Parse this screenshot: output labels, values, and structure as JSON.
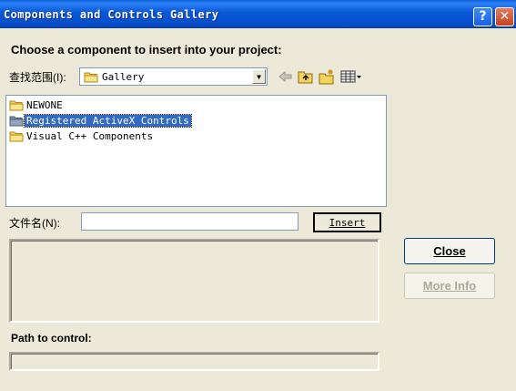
{
  "window": {
    "title": "Components and Controls Gallery",
    "help_glyph": "?",
    "close_glyph": "✕"
  },
  "prompt": "Choose a component to insert into your project:",
  "lookin": {
    "label": "查找范围(I):",
    "value": "Gallery"
  },
  "toolbar": {
    "icons": [
      "back-arrow-icon",
      "up-folder-icon",
      "new-folder-icon",
      "view-menu-icon"
    ]
  },
  "list": {
    "items": [
      {
        "label": "NEWONE",
        "selected": false
      },
      {
        "label": "Registered ActiveX Controls",
        "selected": true
      },
      {
        "label": "Visual C++ Components",
        "selected": false
      }
    ]
  },
  "filename": {
    "label": "文件名(N):",
    "value": ""
  },
  "buttons": {
    "insert": "Insert",
    "close": "Close",
    "more_info": "More Info"
  },
  "path": {
    "label": "Path to control:",
    "value": ""
  },
  "colors": {
    "title_bar": "#0a58d8",
    "selection": "#316ac5",
    "dialog_bg": "#ece9d8"
  }
}
